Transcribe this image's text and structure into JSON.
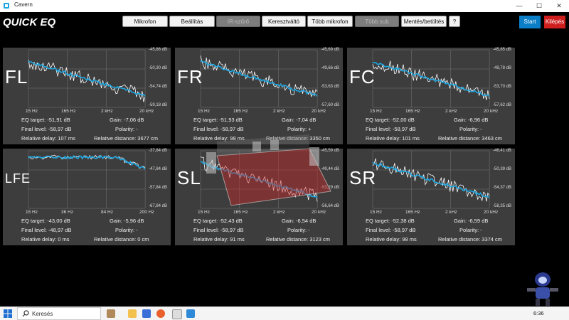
{
  "window": {
    "title": "Cavern",
    "minimize": "—",
    "maximize": "☐",
    "close": "✕"
  },
  "logo": {
    "text": "QUICK EQ",
    "accent": "#1ea7e1"
  },
  "toolbar": {
    "buttons": [
      {
        "label": "Mikrofon",
        "enabled": true
      },
      {
        "label": "Beállítás",
        "enabled": true
      },
      {
        "label": "IR-szűrő",
        "enabled": false
      },
      {
        "label": "Keresztváltó",
        "enabled": true
      },
      {
        "label": "Több mikrofon",
        "enabled": true
      },
      {
        "label": "Több sub",
        "enabled": false
      },
      {
        "label": "Mentés/betöltés",
        "enabled": true
      },
      {
        "label": "?",
        "enabled": true
      }
    ],
    "start": "Start",
    "exit": "Kilépés"
  },
  "colors": {
    "panel": "#3d3d3d",
    "curve_eq": "#1ea7e1",
    "curve_meas": "#ffffff",
    "start": "#0a7fc7",
    "exit": "#d01f1f"
  },
  "channels": [
    {
      "name": "FL",
      "db": [
        "-45,86 dB",
        "-50,30 dB",
        "-54,74 dB",
        "-59,18 dB"
      ],
      "freq": [
        "15 Hz",
        "165 Hz",
        "2 kHz",
        "20 kHz"
      ],
      "eq_target": "EQ target: -51,91 dB",
      "gain": "Gain: -7,06 dB",
      "final_level": "Final level: -58,97 dB",
      "polarity": "Polarity: -",
      "relative_delay": "Relative delay: 107 ms",
      "relative_distance": "Relative distance: 3677 cm"
    },
    {
      "name": "FR",
      "db": [
        "-45,69 dB",
        "-49,66 dB",
        "-53,63 dB",
        "-57,60 dB"
      ],
      "freq": [
        "15 Hz",
        "165 Hz",
        "2 kHz",
        "20 kHz"
      ],
      "eq_target": "EQ target: -51,93 dB",
      "gain": "Gain: -7,04 dB",
      "final_level": "Final level: -58,97 dB",
      "polarity": "Polarity: +",
      "relative_delay": "Relative delay: 98 ms",
      "relative_distance": "Relative distance: 3350 cm"
    },
    {
      "name": "FC",
      "db": [
        "-45,85 dB",
        "-49,78 dB",
        "-53,70 dB",
        "-57,62 dB"
      ],
      "freq": [
        "15 Hz",
        "165 Hz",
        "2 kHz",
        "20 kHz"
      ],
      "eq_target": "EQ target: -52,00 dB",
      "gain": "Gain: -6,96 dB",
      "final_level": "Final level: -58,97 dB",
      "polarity": "Polarity: -",
      "relative_delay": "Relative delay: 101 ms",
      "relative_distance": "Relative distance: 3463 cm"
    },
    {
      "name": "LFE",
      "db": [
        "-37,84 dB",
        "-47,84 dB",
        "-57,84 dB",
        "-67,84 dB"
      ],
      "freq": [
        "15 Hz",
        "36 Hz",
        "84 Hz",
        "200 Hz"
      ],
      "eq_target": "EQ target: -43,00 dB",
      "gain": "Gain: -5,96 dB",
      "final_level": "Final level: -48,97 dB",
      "polarity": "Polarity: -",
      "relative_delay": "Relative delay: 0 ms",
      "relative_distance": "Relative distance: 0 cm"
    },
    {
      "name": "SL",
      "db": [
        "-45,59 dB",
        "-49,44 dB",
        "-53,29 dB",
        "-56,64 dB"
      ],
      "freq": [
        "15 Hz",
        "165 Hz",
        "2 kHz",
        "20 kHz"
      ],
      "eq_target": "EQ target: -52,43 dB",
      "gain": "Gain: -6,54 dB",
      "final_level": "Final level: -58,97 dB",
      "polarity": "Polarity: -",
      "relative_delay": "Relative delay: 91 ms",
      "relative_distance": "Relative distance: 3123 cm"
    },
    {
      "name": "SR",
      "db": [
        "-46,41 dB",
        "-50,39 dB",
        "-54,37 dB",
        "-58,35 dB"
      ],
      "freq": [
        "15 Hz",
        "165 Hz",
        "2 kHz",
        "20 kHz"
      ],
      "eq_target": "EQ target: -52,38 dB",
      "gain": "Gain: -6,59 dB",
      "final_level": "Final level: -58,97 dB",
      "polarity": "Polarity: -",
      "relative_delay": "Relative delay: 98 ms",
      "relative_distance": "Relative distance: 3374 cm"
    }
  ],
  "taskbar": {
    "search_placeholder": "Keresés",
    "time": "6:36",
    "icons": [
      "windows-icon",
      "search-icon",
      "cortana-icon",
      "file-explorer-icon",
      "save-icon",
      "firefox-icon",
      "window-icon",
      "settings-icon"
    ]
  }
}
